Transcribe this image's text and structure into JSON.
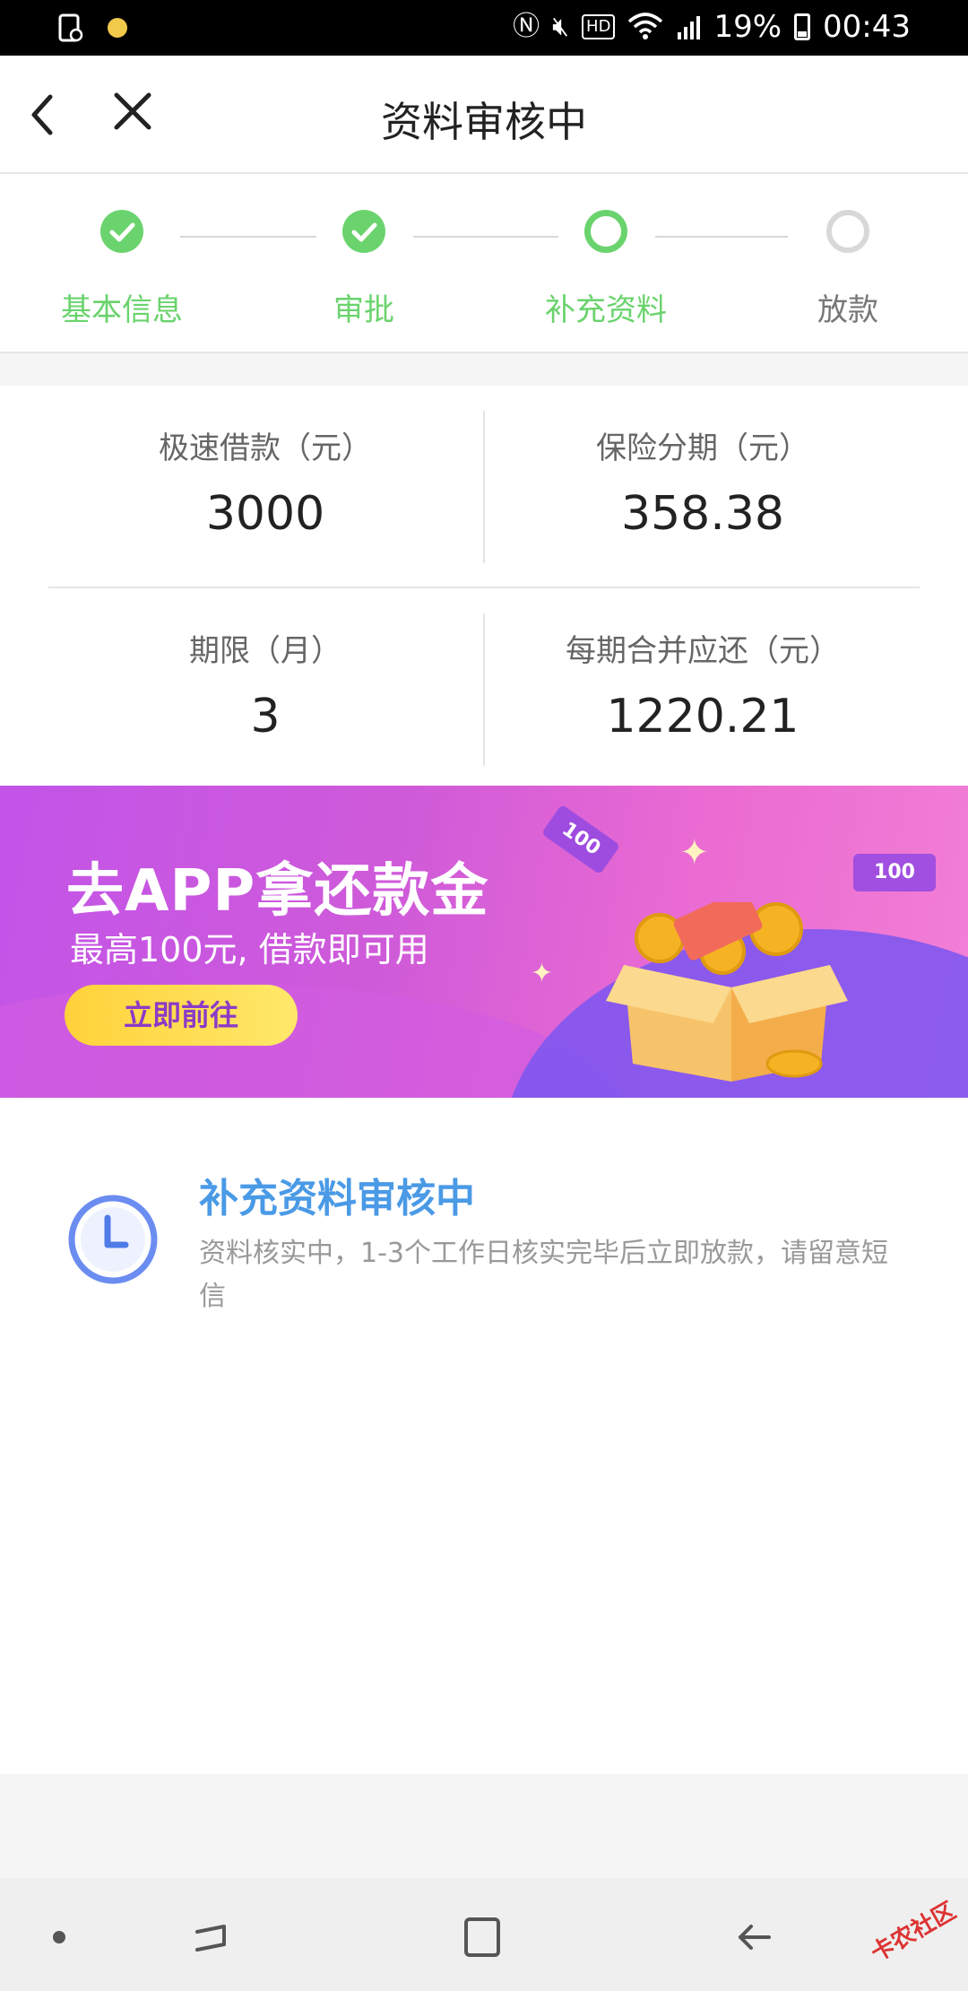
{
  "status_bar": {
    "battery": "19%",
    "time": "00:43",
    "icons": [
      "notification-icon",
      "nfc-icon",
      "mute-icon",
      "hd-icon",
      "wifi-icon",
      "signal-icon",
      "battery-icon"
    ]
  },
  "header": {
    "title": "资料审核中",
    "back_icon": "chevron-left-icon",
    "close_icon": "close-icon"
  },
  "steps": [
    {
      "label": "基本信息",
      "state": "done"
    },
    {
      "label": "审批",
      "state": "done"
    },
    {
      "label": "补充资料",
      "state": "current"
    },
    {
      "label": "放款",
      "state": "todo"
    }
  ],
  "info": {
    "loan_label": "极速借款（元）",
    "loan_value": "3000",
    "insurance_label": "保险分期（元）",
    "insurance_value": "358.38",
    "term_label": "期限（月）",
    "term_value": "3",
    "repay_label": "每期合并应还（元）",
    "repay_value": "1220.21"
  },
  "banner": {
    "title": "去APP拿还款金",
    "subtitle": "最高100元, 借款即可用",
    "button": "立即前往",
    "ticket_text": "100",
    "colors": {
      "accent": "#c254e8",
      "button": "#ffd23a"
    }
  },
  "review": {
    "title": "补充资料审核中",
    "description": "资料核实中，1-3个工作日核实完毕后立即放款，请留意短信",
    "icon": "clock-icon"
  },
  "watermark": "卡农社区",
  "colors": {
    "green": "#6ad36d",
    "blue": "#4a9ae6"
  }
}
